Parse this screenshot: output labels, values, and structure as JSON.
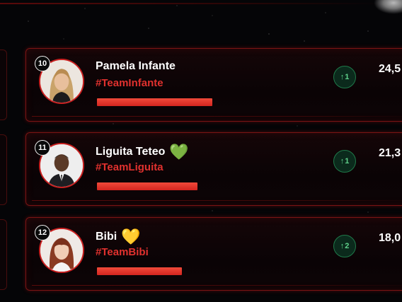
{
  "colors": {
    "accent_red": "#e0312e",
    "card_border": "#7a1414",
    "trend_green": "#5fd08a",
    "background": "#050507"
  },
  "entries": [
    {
      "rank": "10",
      "name": "Pamela Infante",
      "heart": "",
      "team": "#TeamInfante",
      "trend_arrow": "↑",
      "trend_value": "1",
      "votes": "24,5",
      "bar_fraction": 1.0,
      "avatar": "woman-blonde"
    },
    {
      "rank": "11",
      "name": "Liguita Teteo",
      "heart": "💚",
      "team": "#TeamLiguita",
      "trend_arrow": "↑",
      "trend_value": "1",
      "votes": "21,3",
      "bar_fraction": 0.87,
      "avatar": "man-suit"
    },
    {
      "rank": "12",
      "name": "Bibi",
      "heart": "💛",
      "team": "#TeamBibi",
      "trend_arrow": "↑",
      "trend_value": "2",
      "votes": "18,0",
      "bar_fraction": 0.74,
      "avatar": "woman-redhair"
    }
  ]
}
